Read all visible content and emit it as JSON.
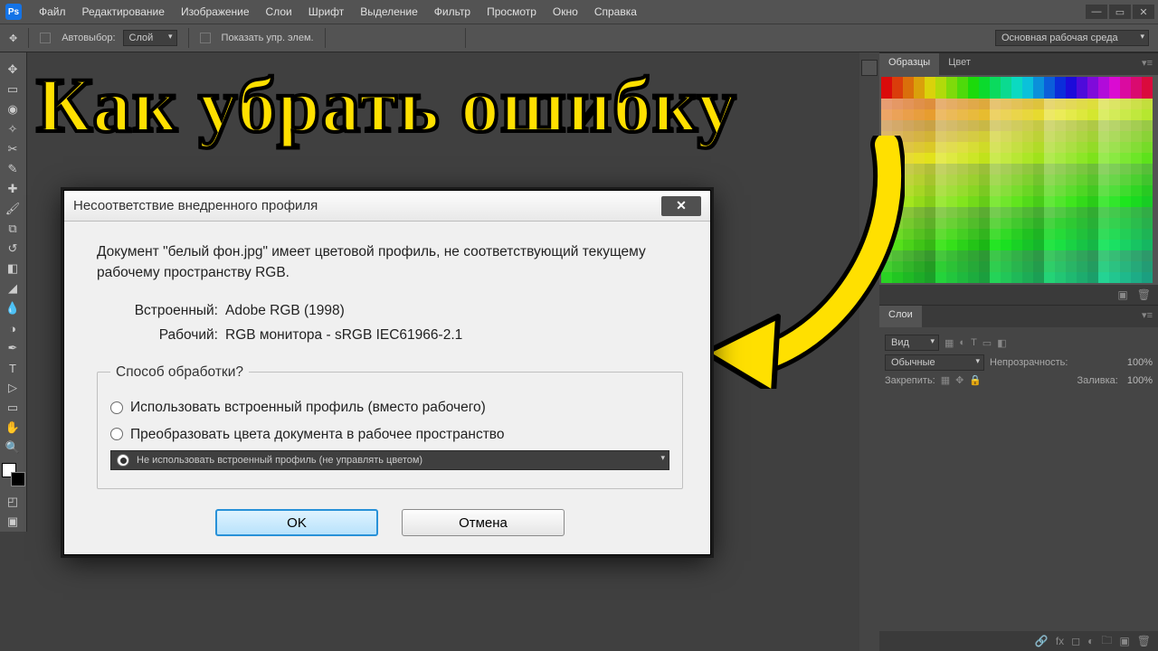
{
  "menubar": {
    "items": [
      "Файл",
      "Редактирование",
      "Изображение",
      "Слои",
      "Шрифт",
      "Выделение",
      "Фильтр",
      "Просмотр",
      "Окно",
      "Справка"
    ]
  },
  "optbar": {
    "autoSelectLabel": "Автовыбор:",
    "autoSelectMode": "Слой",
    "showTransformLabel": "Показать упр. элем.",
    "workspaceLabel": "Основная рабочая среда"
  },
  "panels": {
    "swatches": {
      "tab1": "Образцы",
      "tab2": "Цвет"
    },
    "layers": {
      "tab1": "Слои",
      "kindLabel": "Вид",
      "blendMode": "Обычные",
      "opacityLabel": "Непрозрачность:",
      "opacityValue": "100%",
      "lockLabel": "Закрепить:",
      "fillLabel": "Заливка:",
      "fillValue": "100%"
    }
  },
  "overlayTitle": "Как убрать ошибку",
  "dialog": {
    "title": "Несоответствие внедренного профиля",
    "message": "Документ \"белый фон.jpg\" имеет цветовой профиль, не соответствующий текущему рабочему пространству RGB.",
    "embeddedLabel": "Встроенный:",
    "embeddedValue": "Adobe RGB (1998)",
    "workingLabel": "Рабочий:",
    "workingValue": "RGB монитора - sRGB IEC61966-2.1",
    "groupLabel": "Способ обработки?",
    "options": [
      "Использовать встроенный профиль (вместо рабочего)",
      "Преобразовать цвета документа в рабочее пространство",
      "Не использовать встроенный профиль (не управлять цветом)"
    ],
    "selectedIndex": 2,
    "ok": "OK",
    "cancel": "Отмена"
  }
}
